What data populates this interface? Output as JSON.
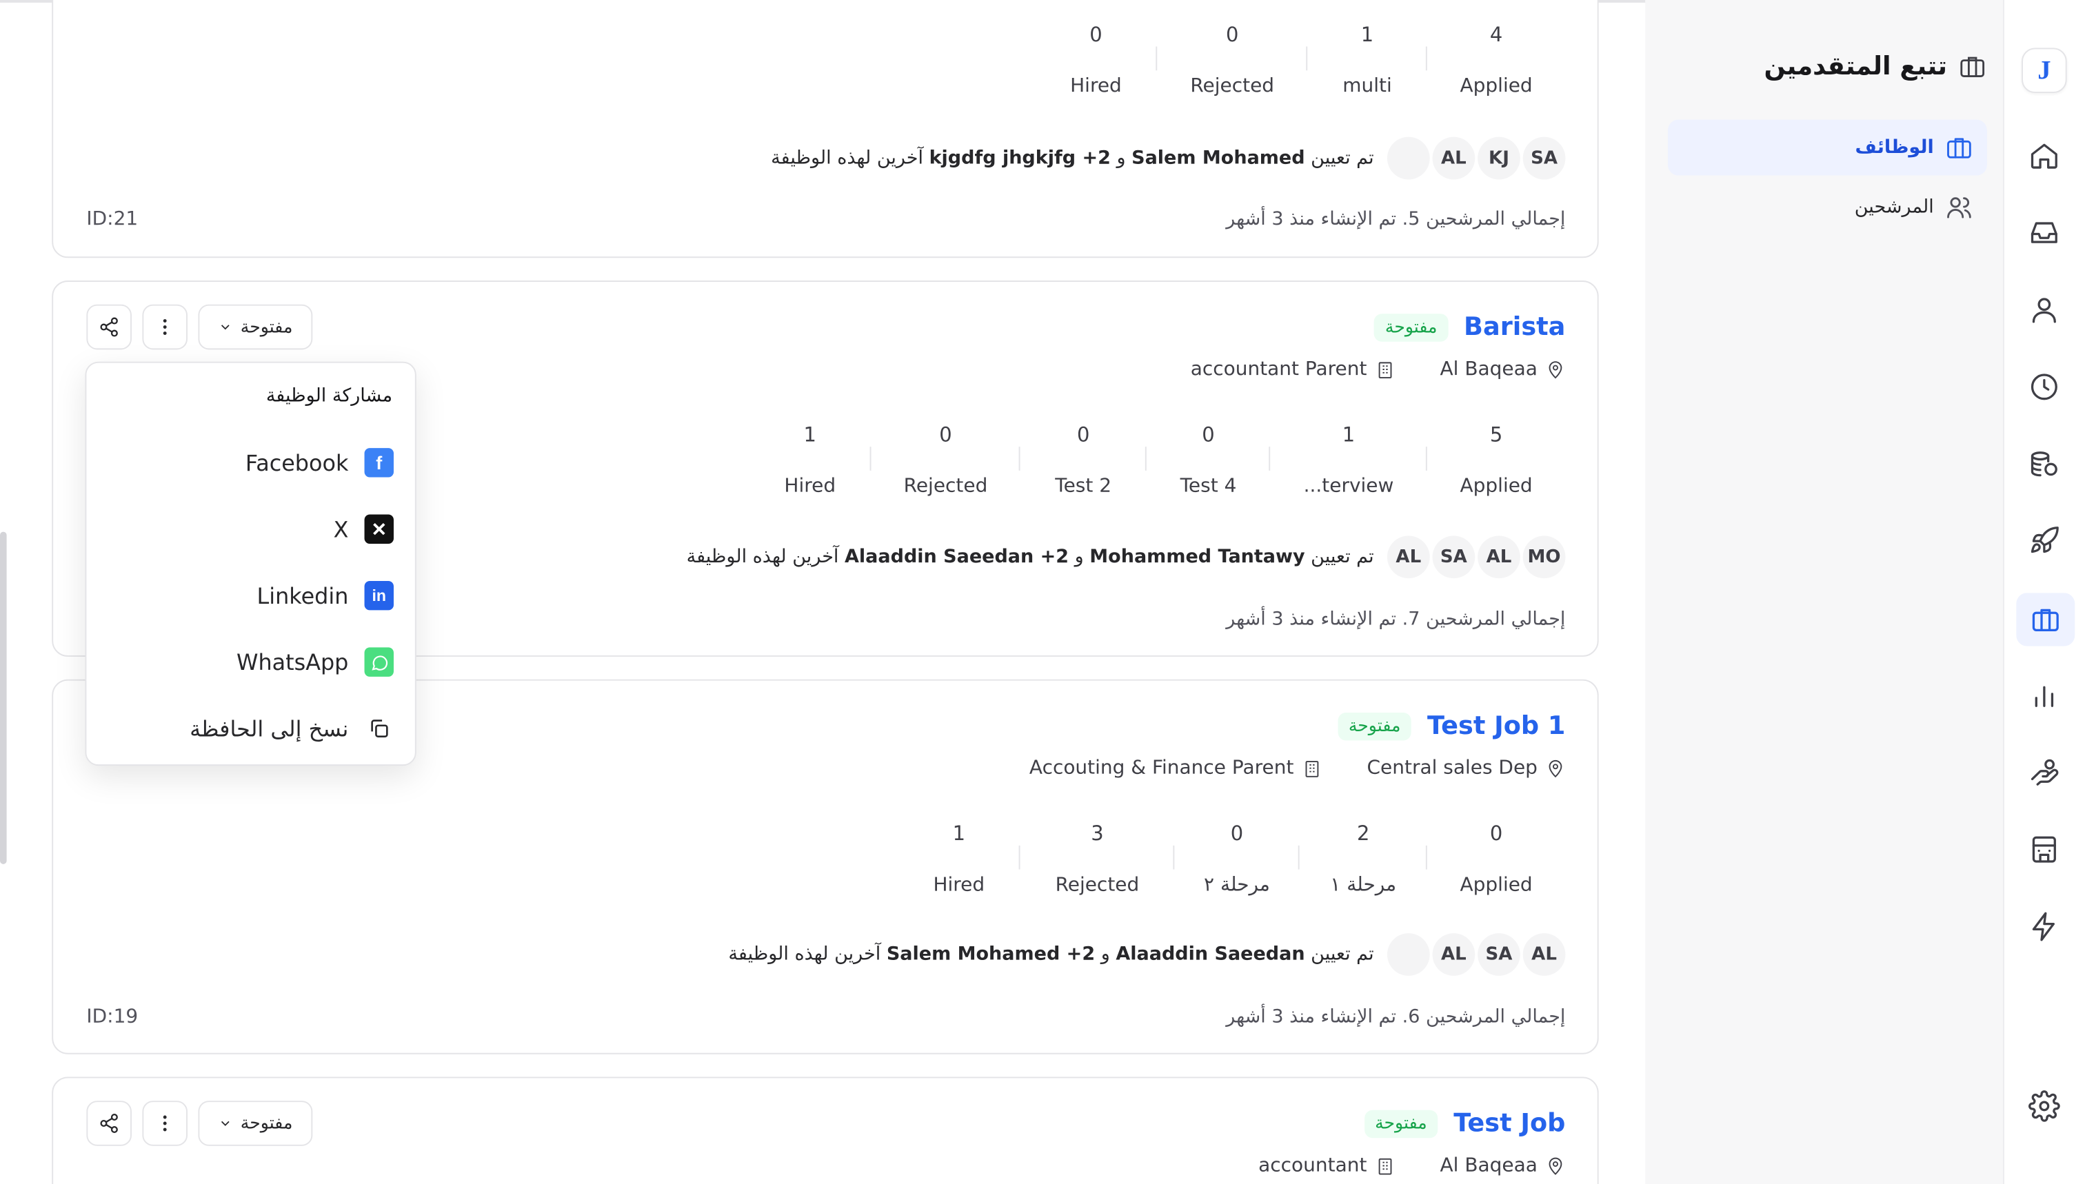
{
  "sidebar": {
    "title": "تتبع المتقدمين",
    "items": [
      {
        "label": "الوظائف"
      },
      {
        "label": "المرشحين"
      }
    ]
  },
  "rail": {
    "logo": "J",
    "icons": [
      "home-icon",
      "inbox-icon",
      "user-icon",
      "clock-icon",
      "coins-icon",
      "rocket-icon",
      "briefcase-icon",
      "bar-chart-icon",
      "hand-coins-icon",
      "building-icon",
      "lightning-icon",
      "settings-icon"
    ]
  },
  "cards": [
    {
      "stages": [
        {
          "num": "4",
          "label": "Applied"
        },
        {
          "num": "1",
          "label": "multi"
        },
        {
          "num": "0",
          "label": "Rejected"
        },
        {
          "num": "0",
          "label": "Hired"
        }
      ],
      "avatars": [
        "AL",
        "KJ",
        "SA"
      ],
      "assign_prefix": "تم تعيين",
      "assign_name1": "Salem Mohamed",
      "assign_and": "و",
      "assign_name2": "kjgdfg jhgkjfg +2",
      "assign_suffix": "آخرين لهذه الوظيفة",
      "footer": "إجمالي المرشحين 5. تم الإنشاء منذ 3 أشهر",
      "id": "ID:21"
    },
    {
      "title": "Barista",
      "status": "مفتوحة",
      "location": "Al Baqeaa",
      "department": "accountant Parent",
      "stages": [
        {
          "num": "5",
          "label": "Applied"
        },
        {
          "num": "1",
          "label": "...terview"
        },
        {
          "num": "0",
          "label": "Test 4"
        },
        {
          "num": "0",
          "label": "Test 2"
        },
        {
          "num": "0",
          "label": "Rejected"
        },
        {
          "num": "1",
          "label": "Hired"
        }
      ],
      "avatars": [
        "AL",
        "SA",
        "AL",
        "MO"
      ],
      "assign_prefix": "تم تعيين",
      "assign_name1": "Mohammed Tantawy",
      "assign_and": "و",
      "assign_name2": "Alaaddin Saeedan +2",
      "assign_suffix": "آخرين لهذه الوظيفة",
      "footer": "إجمالي المرشحين 7. تم الإنشاء منذ 3 أشهر",
      "select_label": "مفتوحة"
    },
    {
      "title": "Test Job 1",
      "status": "مفتوحة",
      "location": "Central sales Dep",
      "department": "Accouting & Finance Parent",
      "stages": [
        {
          "num": "0",
          "label": "Applied"
        },
        {
          "num": "2",
          "label": "مرحلة ١"
        },
        {
          "num": "0",
          "label": "مرحلة ٢"
        },
        {
          "num": "3",
          "label": "Rejected"
        },
        {
          "num": "1",
          "label": "Hired"
        }
      ],
      "avatars": [
        "AL",
        "SA",
        "AL"
      ],
      "assign_prefix": "تم تعيين",
      "assign_name1": "Alaaddin Saeedan",
      "assign_and": "و",
      "assign_name2": "Salem Mohamed +2",
      "assign_suffix": "آخرين لهذه الوظيفة",
      "footer": "إجمالي المرشحين 6. تم الإنشاء منذ 3 أشهر",
      "id": "ID:19"
    },
    {
      "title": "Test Job",
      "status": "مفتوحة",
      "location": "Al Baqeaa",
      "department": "accountant",
      "select_label": "مفتوحة"
    }
  ],
  "share_popup": {
    "title": "مشاركة الوظيفة",
    "items": [
      {
        "label": "Facebook"
      },
      {
        "label": "X"
      },
      {
        "label": "Linkedin"
      },
      {
        "label": "WhatsApp"
      },
      {
        "label": "نسخ إلى الحافظة"
      }
    ]
  }
}
